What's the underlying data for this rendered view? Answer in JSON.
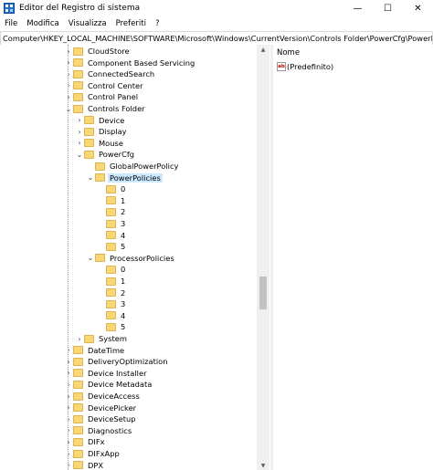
{
  "window": {
    "title": "Editor del Registro di sistema",
    "controls": {
      "minimize": "—",
      "maximize": "☐",
      "close": "✕"
    }
  },
  "menu": [
    "File",
    "Modifica",
    "Visualizza",
    "Preferiti",
    "?"
  ],
  "address": "Computer\\HKEY_LOCAL_MACHINE\\SOFTWARE\\Microsoft\\Windows\\CurrentVersion\\Controls Folder\\PowerCfg\\PowerPolicies",
  "tree": [
    {
      "label": "CloudStore",
      "level": 0,
      "expander": "collapsed"
    },
    {
      "label": "Component Based Servicing",
      "level": 0,
      "expander": "collapsed"
    },
    {
      "label": "ConnectedSearch",
      "level": 0,
      "expander": "collapsed"
    },
    {
      "label": "Control Center",
      "level": 0,
      "expander": "collapsed"
    },
    {
      "label": "Control Panel",
      "level": 0,
      "expander": "collapsed"
    },
    {
      "label": "Controls Folder",
      "level": 0,
      "expander": "expanded"
    },
    {
      "label": "Device",
      "level": 1,
      "expander": "collapsed"
    },
    {
      "label": "Display",
      "level": 1,
      "expander": "collapsed"
    },
    {
      "label": "Mouse",
      "level": 1,
      "expander": "collapsed"
    },
    {
      "label": "PowerCfg",
      "level": 1,
      "expander": "expanded"
    },
    {
      "label": "GlobalPowerPolicy",
      "level": 2,
      "expander": "none"
    },
    {
      "label": "PowerPolicies",
      "level": 2,
      "expander": "expanded",
      "selected": true
    },
    {
      "label": "0",
      "level": 3,
      "expander": "none"
    },
    {
      "label": "1",
      "level": 3,
      "expander": "none"
    },
    {
      "label": "2",
      "level": 3,
      "expander": "none"
    },
    {
      "label": "3",
      "level": 3,
      "expander": "none"
    },
    {
      "label": "4",
      "level": 3,
      "expander": "none"
    },
    {
      "label": "5",
      "level": 3,
      "expander": "none"
    },
    {
      "label": "ProcessorPolicies",
      "level": 2,
      "expander": "expanded"
    },
    {
      "label": "0",
      "level": 3,
      "expander": "none"
    },
    {
      "label": "1",
      "level": 3,
      "expander": "none"
    },
    {
      "label": "2",
      "level": 3,
      "expander": "none"
    },
    {
      "label": "3",
      "level": 3,
      "expander": "none"
    },
    {
      "label": "4",
      "level": 3,
      "expander": "none"
    },
    {
      "label": "5",
      "level": 3,
      "expander": "none"
    },
    {
      "label": "System",
      "level": 1,
      "expander": "collapsed"
    },
    {
      "label": "DateTime",
      "level": 0,
      "expander": "collapsed"
    },
    {
      "label": "DeliveryOptimization",
      "level": 0,
      "expander": "collapsed"
    },
    {
      "label": "Device Installer",
      "level": 0,
      "expander": "collapsed"
    },
    {
      "label": "Device Metadata",
      "level": 0,
      "expander": "collapsed"
    },
    {
      "label": "DeviceAccess",
      "level": 0,
      "expander": "collapsed"
    },
    {
      "label": "DevicePicker",
      "level": 0,
      "expander": "collapsed"
    },
    {
      "label": "DeviceSetup",
      "level": 0,
      "expander": "collapsed"
    },
    {
      "label": "Diagnostics",
      "level": 0,
      "expander": "collapsed"
    },
    {
      "label": "DIFx",
      "level": 0,
      "expander": "collapsed"
    },
    {
      "label": "DIFxApp",
      "level": 0,
      "expander": "collapsed"
    },
    {
      "label": "DPX",
      "level": 0,
      "expander": "collapsed"
    }
  ],
  "values_pane": {
    "column_name": "Nome",
    "values": [
      {
        "icon": "ab",
        "name": "(Predefinito)"
      }
    ]
  },
  "colors": {
    "folder": "#f8d775",
    "selection": "#cce8ff"
  }
}
